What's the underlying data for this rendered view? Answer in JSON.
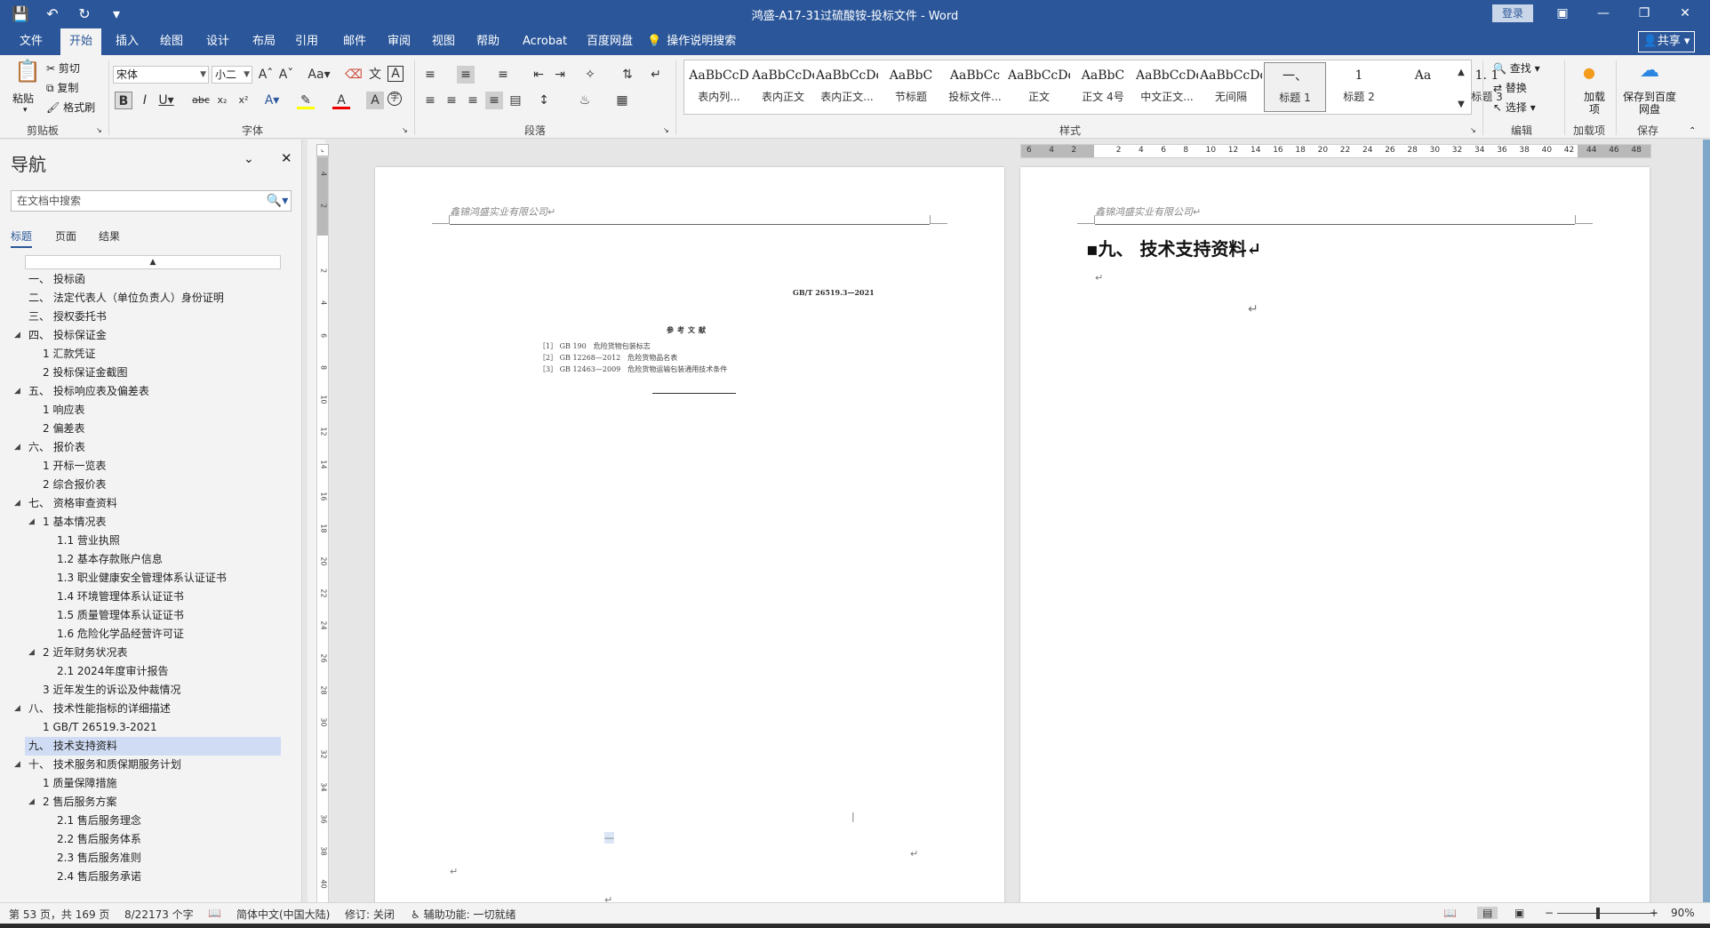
{
  "titlebar": {
    "title": "鸿盛-A17-31过硫酸铵-投标文件 - Word",
    "login": "登录",
    "qat": [
      "save-icon",
      "undo-icon",
      "redo-icon",
      "customize-icon"
    ]
  },
  "tabs": [
    "文件",
    "开始",
    "插入",
    "绘图",
    "设计",
    "布局",
    "引用",
    "邮件",
    "审阅",
    "视图",
    "帮助",
    "Acrobat",
    "百度网盘"
  ],
  "active_tab": "开始",
  "tellme": "操作说明搜索",
  "share": "共享",
  "ribbon": {
    "clipboard": {
      "paste": "粘贴",
      "cut": "剪切",
      "copy": "复制",
      "format_painter": "格式刷",
      "label": "剪贴板"
    },
    "font": {
      "name": "宋体",
      "size": "小二",
      "label": "字体"
    },
    "paragraph": {
      "label": "段落"
    },
    "styles": {
      "label": "样式",
      "items": [
        {
          "sample": "AaBbCcD",
          "name": "表内列..."
        },
        {
          "sample": "AaBbCcDdI",
          "name": "表内正文"
        },
        {
          "sample": "AaBbCcDd",
          "name": "表内正文..."
        },
        {
          "sample": "AaBbC",
          "name": "节标题"
        },
        {
          "sample": "AaBbCc",
          "name": "投标文件..."
        },
        {
          "sample": "AaBbCcDdI",
          "name": "正文"
        },
        {
          "sample": "AaBbC",
          "name": "正文 4号"
        },
        {
          "sample": "AaBbCcDd",
          "name": "中文正文..."
        },
        {
          "sample": "AaBbCcDdI",
          "name": "无间隔"
        },
        {
          "sample": "一、",
          "name": "标题 1"
        },
        {
          "sample": "1",
          "name": "标题 2"
        },
        {
          "sample": "Aa",
          "name": ""
        },
        {
          "sample": "1. 1",
          "name": "标题 3"
        }
      ]
    },
    "editing": {
      "find": "查找",
      "replace": "替换",
      "select": "选择",
      "label": "编辑"
    },
    "addins": {
      "name": "加载项",
      "label": "加载项"
    },
    "save": {
      "name": "保存到百度网盘",
      "label": "保存"
    }
  },
  "nav": {
    "title": "导航",
    "search_placeholder": "在文档中搜索",
    "tabs": [
      "标题",
      "页面",
      "结果"
    ],
    "items": [
      {
        "text": "一、 投标函",
        "level": 0,
        "tri": false
      },
      {
        "text": "二、 法定代表人（单位负责人）身份证明",
        "level": 0,
        "tri": false
      },
      {
        "text": "三、 授权委托书",
        "level": 0,
        "tri": false
      },
      {
        "text": "四、 投标保证金",
        "level": 0,
        "tri": true
      },
      {
        "text": "1 汇款凭证",
        "level": 1,
        "tri": false
      },
      {
        "text": "2 投标保证金截图",
        "level": 1,
        "tri": false
      },
      {
        "text": "五、 投标响应表及偏差表",
        "level": 0,
        "tri": true
      },
      {
        "text": "1 响应表",
        "level": 1,
        "tri": false
      },
      {
        "text": "2 偏差表",
        "level": 1,
        "tri": false
      },
      {
        "text": "六、 报价表",
        "level": 0,
        "tri": true
      },
      {
        "text": "1 开标一览表",
        "level": 1,
        "tri": false
      },
      {
        "text": "2 综合报价表",
        "level": 1,
        "tri": false
      },
      {
        "text": "七、 资格审查资料",
        "level": 0,
        "tri": true
      },
      {
        "text": "1 基本情况表",
        "level": 1,
        "tri": true
      },
      {
        "text": "1.1 营业执照",
        "level": 2,
        "tri": false
      },
      {
        "text": "1.2 基本存款账户信息",
        "level": 2,
        "tri": false
      },
      {
        "text": "1.3 职业健康安全管理体系认证证书",
        "level": 2,
        "tri": false
      },
      {
        "text": "1.4 环境管理体系认证证书",
        "level": 2,
        "tri": false
      },
      {
        "text": "1.5 质量管理体系认证证书",
        "level": 2,
        "tri": false
      },
      {
        "text": "1.6 危险化学品经营许可证",
        "level": 2,
        "tri": false
      },
      {
        "text": "2 近年财务状况表",
        "level": 1,
        "tri": true
      },
      {
        "text": "2.1 2024年度审计报告",
        "level": 2,
        "tri": false
      },
      {
        "text": "3 近年发生的诉讼及仲裁情况",
        "level": 1,
        "tri": false
      },
      {
        "text": "八、 技术性能指标的详细描述",
        "level": 0,
        "tri": true
      },
      {
        "text": "1 GB/T 26519.3-2021",
        "level": 1,
        "tri": false
      },
      {
        "text": "九、 技术支持资料",
        "level": 0,
        "tri": false,
        "selected": true
      },
      {
        "text": "十、 技术服务和质保期服务计划",
        "level": 0,
        "tri": true
      },
      {
        "text": "1 质量保障措施",
        "level": 1,
        "tri": false
      },
      {
        "text": "2 售后服务方案",
        "level": 1,
        "tri": true
      },
      {
        "text": "2.1 售后服务理念",
        "level": 2,
        "tri": false
      },
      {
        "text": "2.2 售后服务体系",
        "level": 2,
        "tri": false
      },
      {
        "text": "2.3 售后服务准则",
        "level": 2,
        "tri": false
      },
      {
        "text": "2.4 售后服务承诺",
        "level": 2,
        "tri": false
      }
    ]
  },
  "pages": {
    "left": {
      "header": "鑫锦鸿盛实业有限公司↵",
      "std_no": "GB/T 26519.3—2021",
      "refs_title": "参考文献",
      "refs": [
        "［1］ GB 190　危险货物包装标志",
        "［2］ GB 12268—2012　危险货物品名表",
        "［3］ GB 12463—2009　危险货物运输包装通用技术条件"
      ]
    },
    "right": {
      "header": "鑫锦鸿盛实业有限公司↵",
      "heading": "九、 技术支持资料↵"
    }
  },
  "hruler_nums": [
    "6",
    "4",
    "2",
    "",
    "2",
    "4",
    "6",
    "8",
    "10",
    "12",
    "14",
    "16",
    "18",
    "20",
    "22",
    "24",
    "26",
    "28",
    "30",
    "32",
    "34",
    "36",
    "38",
    "40",
    "42",
    "44",
    "46",
    "48"
  ],
  "vruler_nums": [
    "4",
    "2",
    "",
    "2",
    "4",
    "6",
    "8",
    "10",
    "12",
    "14",
    "16",
    "18",
    "20",
    "22",
    "24",
    "26",
    "28",
    "30",
    "32",
    "34",
    "36",
    "38",
    "40"
  ],
  "status": {
    "page": "第 53 页，共 169 页",
    "words": "8/22173 个字",
    "language": "简体中文(中国大陆)",
    "track": "修订: 关闭",
    "accessibility": "辅助功能: 一切就绪",
    "zoom": "90%"
  }
}
